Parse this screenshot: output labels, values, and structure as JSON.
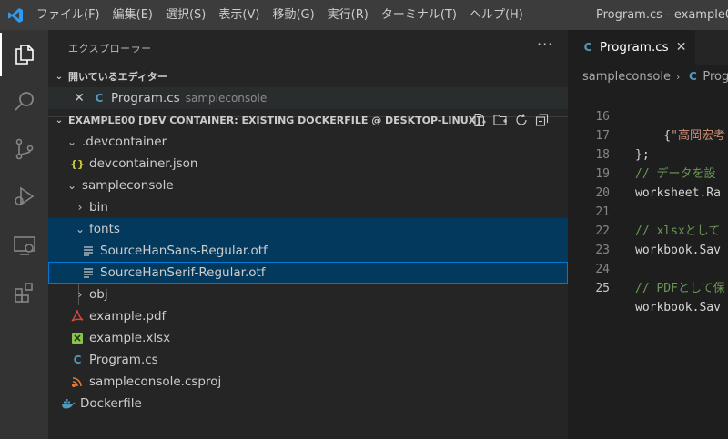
{
  "titlebar": {
    "menu": [
      "ファイル(F)",
      "編集(E)",
      "選択(S)",
      "表示(V)",
      "移動(G)",
      "実行(R)",
      "ターミナル(T)",
      "ヘルプ(H)"
    ],
    "window_title": "Program.cs - example0"
  },
  "activity_bar": {
    "items": [
      "explorer-icon",
      "search-icon",
      "source-control-icon",
      "run-debug-icon",
      "remote-explorer-icon",
      "extensions-icon"
    ],
    "active": "explorer-icon"
  },
  "sidebar": {
    "title": "エクスプローラー",
    "more_label": "···",
    "open_editors": {
      "label": "開いているエディター",
      "items": [
        {
          "name": "Program.cs",
          "description": "sampleconsole"
        }
      ]
    },
    "workspace": {
      "label": "EXAMPLE00 [DEV CONTAINER: EXISTING DOCKERFILE @ DESKTOP-LINUX]",
      "tree": [
        {
          "name": ".devcontainer",
          "type": "folder",
          "expanded": true
        },
        {
          "name": "devcontainer.json",
          "type": "json"
        },
        {
          "name": "sampleconsole",
          "type": "folder",
          "expanded": true
        },
        {
          "name": "bin",
          "type": "folder",
          "expanded": false
        },
        {
          "name": "fonts",
          "type": "folder",
          "expanded": true
        },
        {
          "name": "SourceHanSans-Regular.otf",
          "type": "font"
        },
        {
          "name": "SourceHanSerif-Regular.otf",
          "type": "font"
        },
        {
          "name": "obj",
          "type": "folder",
          "expanded": false
        },
        {
          "name": "example.pdf",
          "type": "pdf"
        },
        {
          "name": "example.xlsx",
          "type": "excel"
        },
        {
          "name": "Program.cs",
          "type": "csharp"
        },
        {
          "name": "sampleconsole.csproj",
          "type": "rss"
        },
        {
          "name": "Dockerfile",
          "type": "docker"
        }
      ]
    }
  },
  "editor": {
    "tab": {
      "label": "Program.cs",
      "close": "✕"
    },
    "breadcrumbs": [
      "sampleconsole",
      "Prog"
    ],
    "lines": [
      {
        "num": "16",
        "text": "    {\"高岡宏考"
      },
      {
        "num": "17",
        "text": "};"
      },
      {
        "num": "18",
        "text": "// データを設"
      },
      {
        "num": "19",
        "text": "worksheet.Ra"
      },
      {
        "num": "20",
        "text": ""
      },
      {
        "num": "21",
        "text": "// xlsxとして"
      },
      {
        "num": "22",
        "text": "workbook.Sav"
      },
      {
        "num": "23",
        "text": ""
      },
      {
        "num": "24",
        "text": "// PDFとして保"
      },
      {
        "num": "25",
        "text": "workbook.Sav"
      }
    ],
    "current_line": "25"
  },
  "colors": {
    "accent": "#0078d4",
    "selection": "#04395e",
    "activity_bar": "#333333",
    "sidebar": "#252526",
    "editor": "#1e1e1e"
  }
}
